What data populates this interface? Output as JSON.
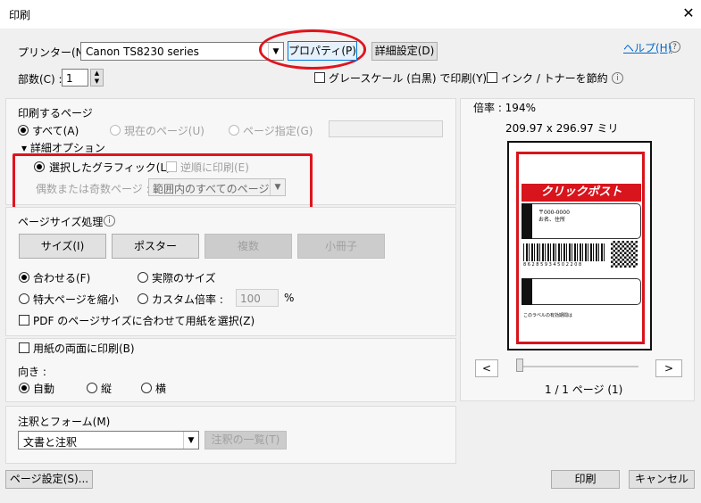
{
  "window": {
    "title": "印刷",
    "close_glyph": "✕"
  },
  "printer": {
    "label": "プリンター(N) :",
    "value": "Canon TS8230 series",
    "properties_btn": "プロパティ(P)",
    "advanced_btn": "詳細設定(D)",
    "help_link": "ヘルプ(H)"
  },
  "copies": {
    "label": "部数(C) :",
    "value": "1"
  },
  "options": {
    "grayscale": "グレースケール (白黒) で印刷(Y)",
    "save_ink": "インク / トナーを節約"
  },
  "pages": {
    "title": "印刷するページ",
    "all": "すべて(A)",
    "current": "現在のページ(U)",
    "range": "ページ指定(G)",
    "more": "▾ 詳細オプション",
    "selected_graphic": "選択したグラフィック(L)",
    "reverse": "逆順に印刷(E)",
    "odd_even_label": "偶数または奇数ページ :",
    "odd_even_value": "範囲内のすべてのページ"
  },
  "sizing": {
    "title": "ページサイズ処理",
    "size_btn": "サイズ(I)",
    "poster_btn": "ポスター",
    "multiple_btn": "複数",
    "booklet_btn": "小冊子",
    "fit": "合わせる(F)",
    "actual": "実際のサイズ",
    "shrink": "特大ページを縮小",
    "custom": "カスタム倍率 :",
    "custom_value": "100",
    "percent": "%",
    "pdf_paper": "PDF のページサイズに合わせて用紙を選択(Z)"
  },
  "duplex": {
    "label": "用紙の両面に印刷(B)"
  },
  "orientation": {
    "title": "向き :",
    "auto": "自動",
    "portrait": "縦",
    "landscape": "横"
  },
  "comments": {
    "title": "注釈とフォーム(M)",
    "value": "文書と注釈",
    "summary_btn": "注釈の一覧(T)"
  },
  "preview": {
    "zoom": "倍率 : 194%",
    "dimensions": "209.97 x 296.97 ミリ",
    "page_nav": "1 / 1 ページ (1)",
    "prev_btn": "<",
    "next_btn": ">",
    "banner_text": "クリックポスト",
    "addr_from": "〒000-0000",
    "addr_name": "お名、住所",
    "addr_to": "〒...",
    "barcode_num": "8 6 2 8 5 9 3 4 5 0 2 2 0 8",
    "footer_note": "このラベルの有効期間は"
  },
  "footer": {
    "page_setup": "ページ設定(S)...",
    "print": "印刷",
    "cancel": "キャンセル"
  },
  "colors": {
    "accent_red": "#e0141e",
    "link": "#0066cc",
    "focus_blue": "#0078d7"
  }
}
